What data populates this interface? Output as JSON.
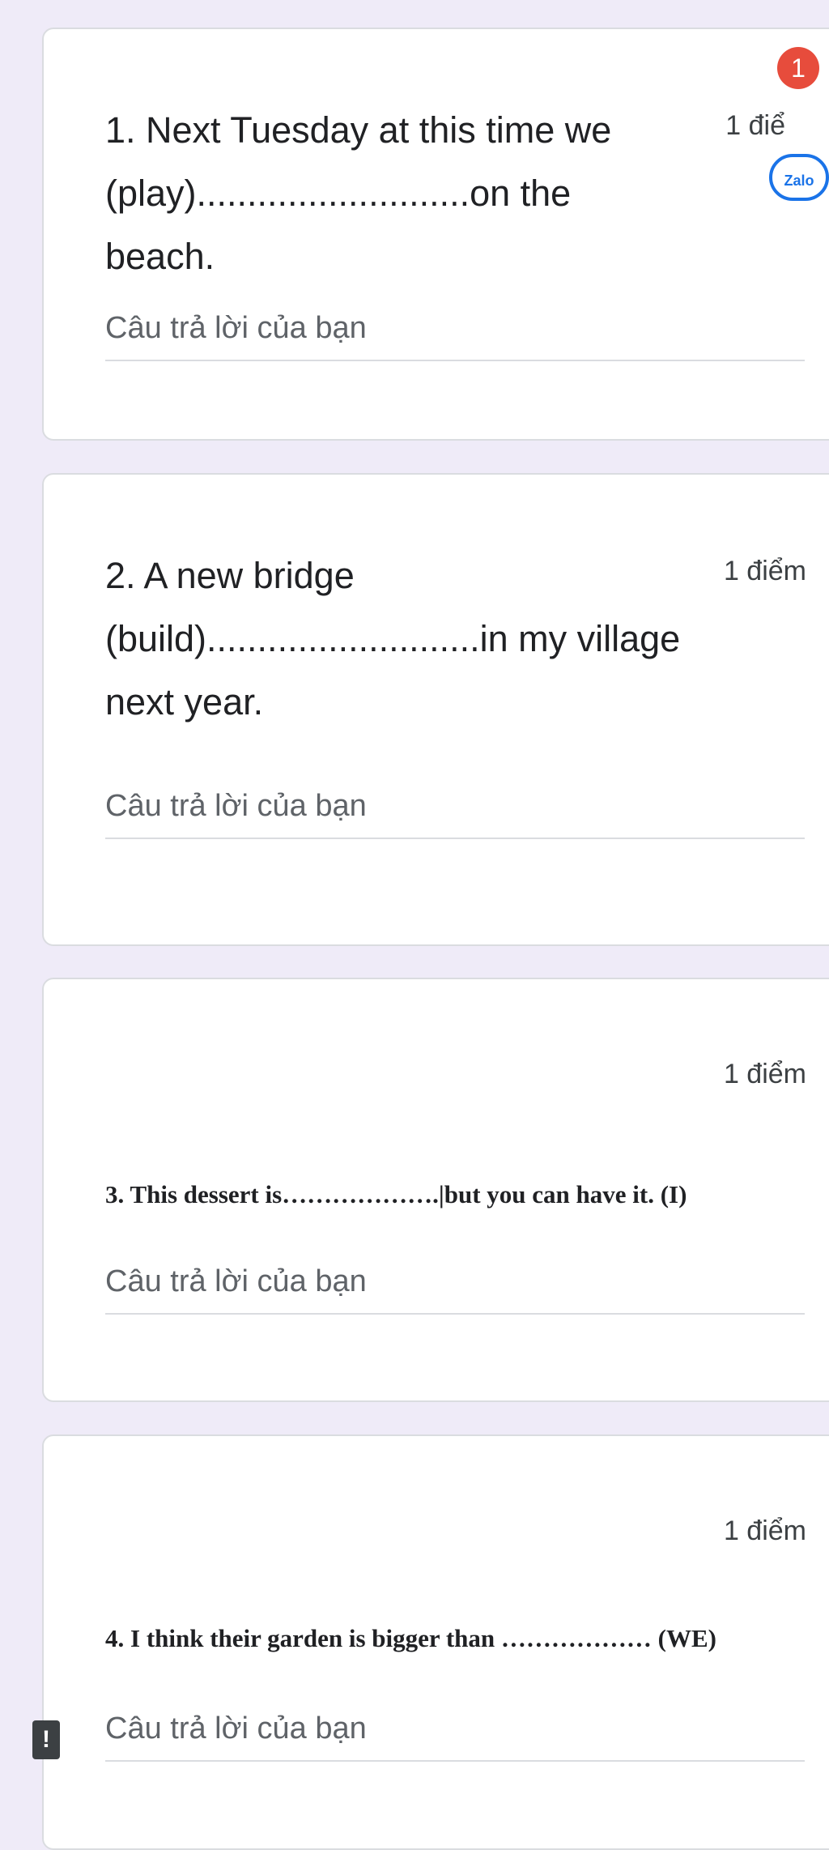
{
  "questions": [
    {
      "text": "1. Next Tuesday at this time we\n(play)...........................on the beach.",
      "points": "1 điể",
      "answer_placeholder": "Câu trả lời của bạn"
    },
    {
      "text": "2. A new bridge\n(build)...........................in my village\nnext year.",
      "points": "1 điểm",
      "answer_placeholder": "Câu trả lời của bạn"
    },
    {
      "text": "3. This dessert is……………….|but you can have it. (I)",
      "points": "1 điểm",
      "answer_placeholder": "Câu trả lời của bạn"
    },
    {
      "text": "4. I think their garden is bigger than ……………… (WE)",
      "points": "1 điểm",
      "answer_placeholder": "Câu trả lời của bạn"
    }
  ],
  "overlay": {
    "notification_count": "1",
    "zalo_label": "Zalo",
    "alert_symbol": "!"
  },
  "icons": [
    "notification-badge",
    "zalo-icon",
    "alert-icon"
  ],
  "colors": {
    "background": "#efebf8",
    "card": "#ffffff",
    "badge": "#e74c3c",
    "zalo": "#1a73e8"
  }
}
